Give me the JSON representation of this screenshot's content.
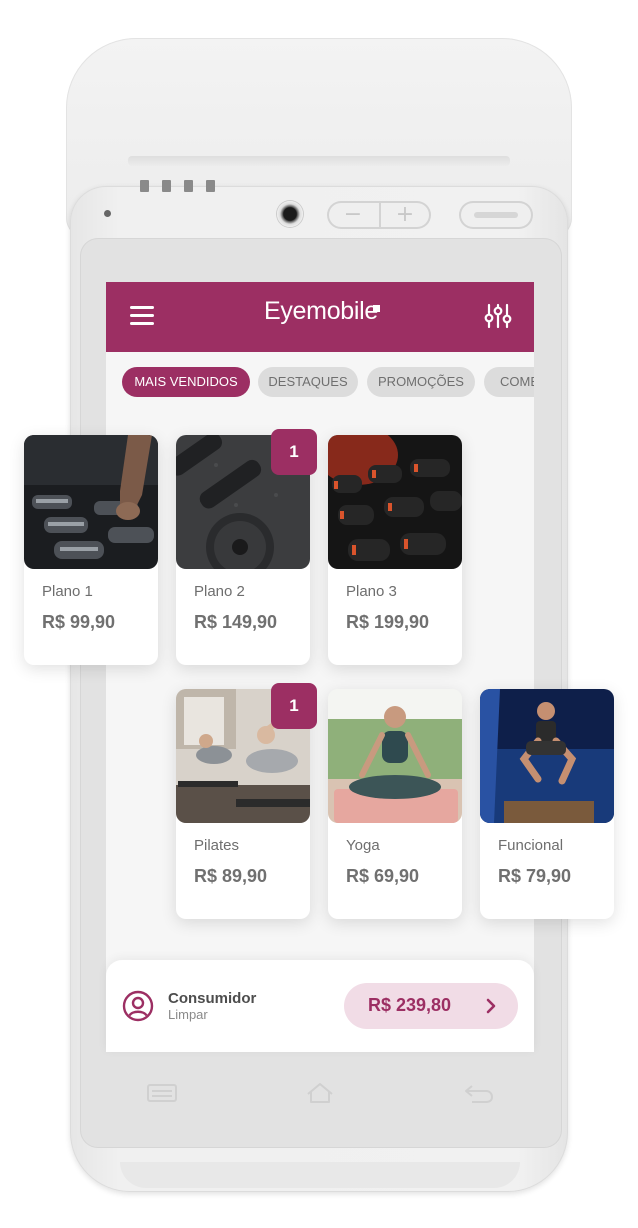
{
  "app": {
    "brand": "Eyemobile",
    "accent_color": "#9c2f63"
  },
  "header": {
    "menu_icon": "hamburger-icon",
    "filter_icon": "sliders-icon"
  },
  "categories": [
    {
      "label": "MAIS VENDIDOS",
      "active": true
    },
    {
      "label": "DESTAQUES",
      "active": false
    },
    {
      "label": "PROMOÇÕES",
      "active": false
    },
    {
      "label": "COMBOS",
      "active": false
    }
  ],
  "products": [
    {
      "name": "Plano 1",
      "price": "R$ 99,90",
      "image": "dumbbell-rack-photo"
    },
    {
      "name": "Plano 2",
      "price": "R$ 149,90",
      "image": "weight-plate-photo",
      "qty": "1"
    },
    {
      "name": "Plano 3",
      "price": "R$ 199,90",
      "image": "red-dumbbells-photo"
    },
    {
      "name": "Pilates",
      "price": "R$ 89,90",
      "image": "pilates-class-photo",
      "qty": "1"
    },
    {
      "name": "Yoga",
      "price": "R$ 69,90",
      "image": "yoga-pose-photo"
    },
    {
      "name": "Funcional",
      "price": "R$ 79,90",
      "image": "box-squat-photo"
    }
  ],
  "footer": {
    "customer_label": "Consumidor",
    "clear_label": "Limpar",
    "total": "R$ 239,80",
    "user_icon": "user-circle-icon",
    "proceed_icon": "chevron-right-icon"
  }
}
